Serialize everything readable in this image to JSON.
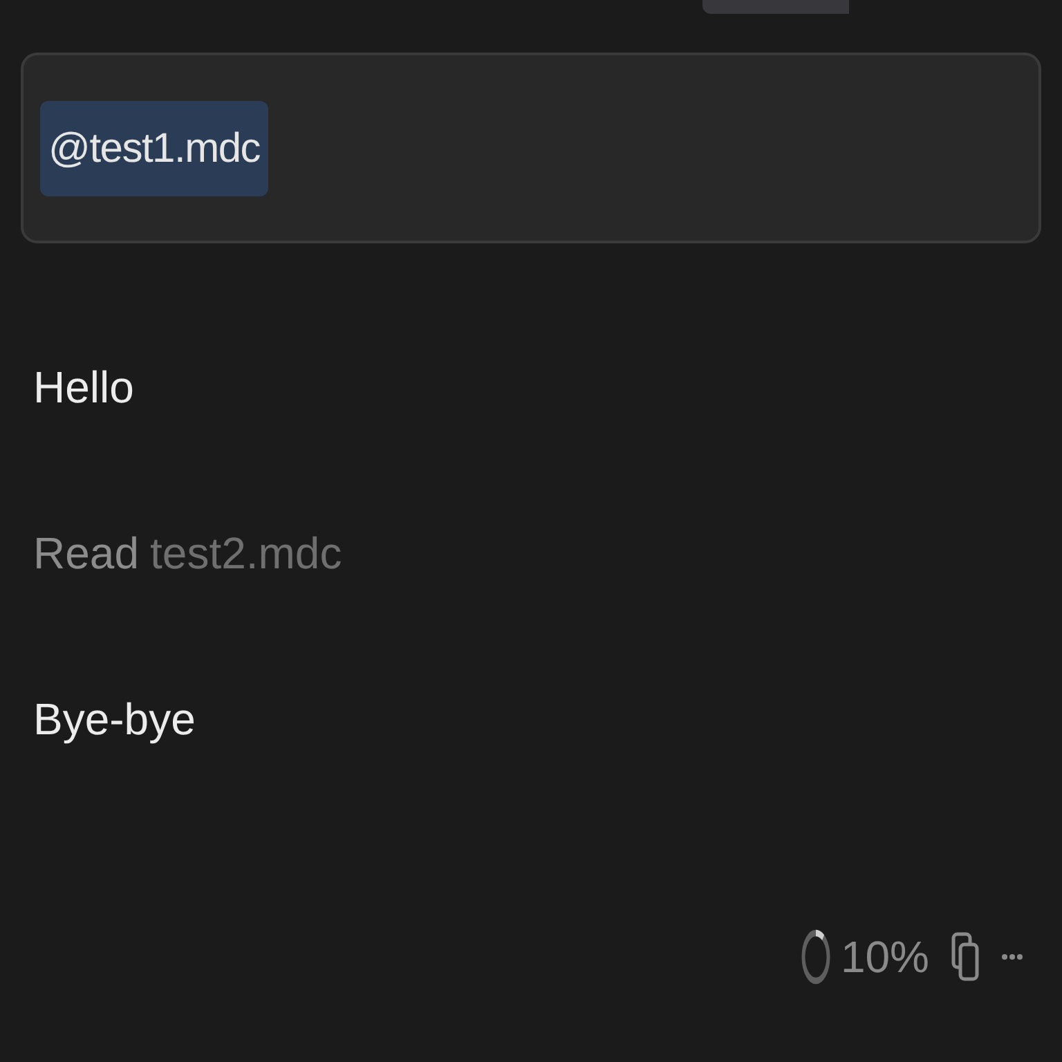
{
  "input": {
    "mention": "@test1.mdc"
  },
  "messages": [
    {
      "kind": "text",
      "text": "Hello"
    },
    {
      "kind": "tool",
      "action": "Read",
      "target": "test2.mdc"
    },
    {
      "kind": "text",
      "text": "Bye-bye"
    }
  ],
  "footer": {
    "context": {
      "level": 0.1,
      "reading": "10%"
    }
  }
}
